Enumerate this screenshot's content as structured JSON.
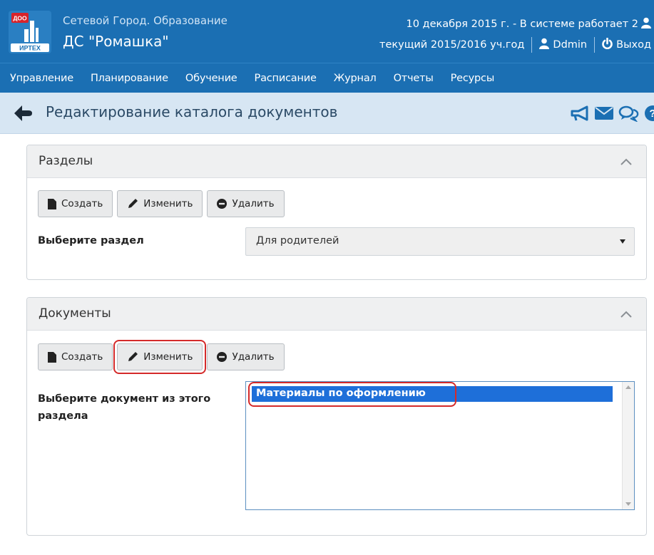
{
  "header": {
    "logo_badge": "ДОО",
    "logo_brand": "ИРТЕХ",
    "app_name": "Сетевой Город. Образование",
    "school_name": "ДС \"Ромашка\"",
    "date_status": "10 декабря 2015 г. - В системе работает 2",
    "school_year": "текущий 2015/2016 уч.год",
    "user_name": "Ddmin",
    "logout_label": "Выход",
    "colors": {
      "bar": "#1b6fb3",
      "muted_text": "#cfe3f5"
    }
  },
  "nav": {
    "items": [
      "Управление",
      "Планирование",
      "Обучение",
      "Расписание",
      "Журнал",
      "Отчеты",
      "Ресурсы"
    ]
  },
  "titlebar": {
    "back_icon": "arrow-left-circle-icon",
    "title": "Редактирование каталога документов",
    "icons": [
      "megaphone-icon",
      "envelope-icon",
      "chat-icon",
      "help-icon"
    ]
  },
  "sections_panel": {
    "title": "Разделы",
    "buttons": {
      "create": "Создать",
      "edit": "Изменить",
      "delete": "Удалить"
    },
    "field_label": "Выберите раздел",
    "selected_value": "Для родителей"
  },
  "documents_panel": {
    "title": "Документы",
    "buttons": {
      "create": "Создать",
      "edit": "Изменить",
      "delete": "Удалить"
    },
    "field_label": "Выберите документ из этого раздела",
    "list_items": [
      "Материалы по оформлению"
    ],
    "highlight_color": "#d42a2a",
    "selection_color": "#1e6fd9"
  }
}
